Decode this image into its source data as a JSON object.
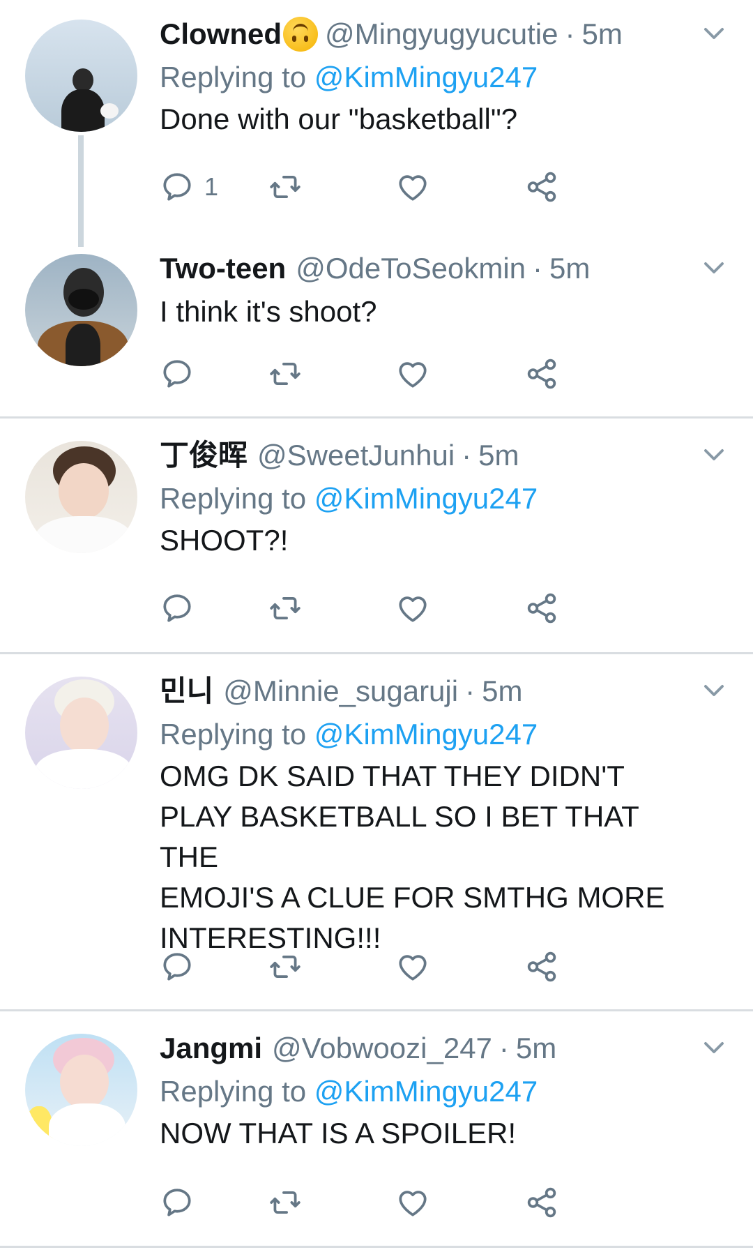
{
  "colors": {
    "primary_text": "#14171a",
    "secondary_text": "#657786",
    "link": "#1da1f2",
    "divider": "#d9dde1",
    "icon": "#657786"
  },
  "tweets": [
    {
      "name": "Clowned",
      "name_emoji": "upside-down-face-emoji",
      "handle": "@Mingyugyucutie",
      "separator": "·",
      "time": "5m",
      "replying_label": "Replying to",
      "replying_to": "@KimMingyu247",
      "text": "Done with our \"basketball\"?",
      "reply_count": "1"
    },
    {
      "name": "Two-teen",
      "handle": "@OdeToSeokmin",
      "separator": "·",
      "time": "5m",
      "text": "I think it's shoot?"
    },
    {
      "name": "丁俊晖",
      "handle": "@SweetJunhui",
      "separator": "·",
      "time": "5m",
      "replying_label": "Replying to",
      "replying_to": "@KimMingyu247",
      "text": "SHOOT?!"
    },
    {
      "name": "민니",
      "handle": "@Minnie_sugaruji",
      "separator": "·",
      "time": "5m",
      "replying_label": "Replying to",
      "replying_to": "@KimMingyu247",
      "text_lines": [
        "OMG DK SAID THAT THEY DIDN'T",
        "PLAY BASKETBALL SO I BET THAT THE",
        "EMOJI'S A CLUE FOR SMTHG MORE",
        "INTERESTING!!!"
      ]
    },
    {
      "name": "Jangmi",
      "handle": "@Vobwoozi_247",
      "separator": "·",
      "time": "5m",
      "replying_label": "Replying to",
      "replying_to": "@KimMingyu247",
      "text": "NOW THAT IS A SPOILER!"
    }
  ],
  "icons": {
    "reply": "reply-icon",
    "retweet": "retweet-icon",
    "like": "heart-icon",
    "share": "share-icon",
    "more": "chevron-down-icon"
  }
}
